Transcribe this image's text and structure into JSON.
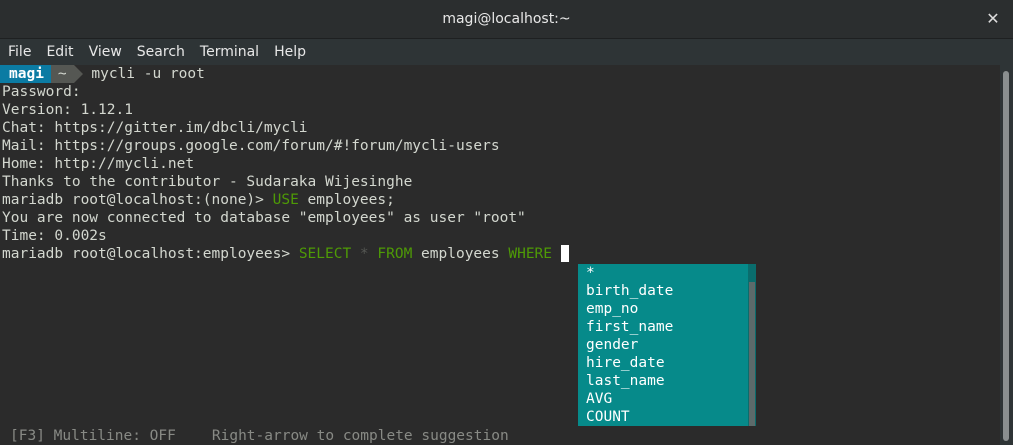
{
  "window": {
    "title": "magi@localhost:~",
    "close_glyph": "✕"
  },
  "menu": [
    "File",
    "Edit",
    "View",
    "Search",
    "Terminal",
    "Help"
  ],
  "prompt": {
    "user": "magi",
    "dir": "~",
    "command": " mycli -u root"
  },
  "lines": [
    "Password:",
    "Version: 1.12.1",
    "Chat: https://gitter.im/dbcli/mycli",
    "Mail: https://groups.google.com/forum/#!forum/mycli-users",
    "Home: http://mycli.net",
    "Thanks to the contributor - Sudaraka Wijesinghe"
  ],
  "use_line": {
    "prompt": "mariadb root@localhost:(none)> ",
    "keyword": "USE",
    "rest": " employees;"
  },
  "connected_line": "You are now connected to database \"employees\" as user \"root\"",
  "time_line": "Time: 0.002s",
  "select_line": {
    "prompt": "mariadb root@localhost:employees> ",
    "kw_select": "SELECT",
    "star": " * ",
    "kw_from": "FROM",
    "table": " employees ",
    "kw_where": "WHERE",
    "trail": " "
  },
  "completions": [
    "*",
    "birth_date",
    "emp_no",
    "first_name",
    "gender",
    "hire_date",
    "last_name",
    "AVG",
    "COUNT"
  ],
  "status": {
    "multiline": "[F3] Multiline: OFF",
    "hint": "Right-arrow to complete suggestion"
  },
  "colors": {
    "keyword": "#4e9a06",
    "popup_bg": "#068a8a",
    "prompt_user_bg": "#0b7ba3"
  }
}
